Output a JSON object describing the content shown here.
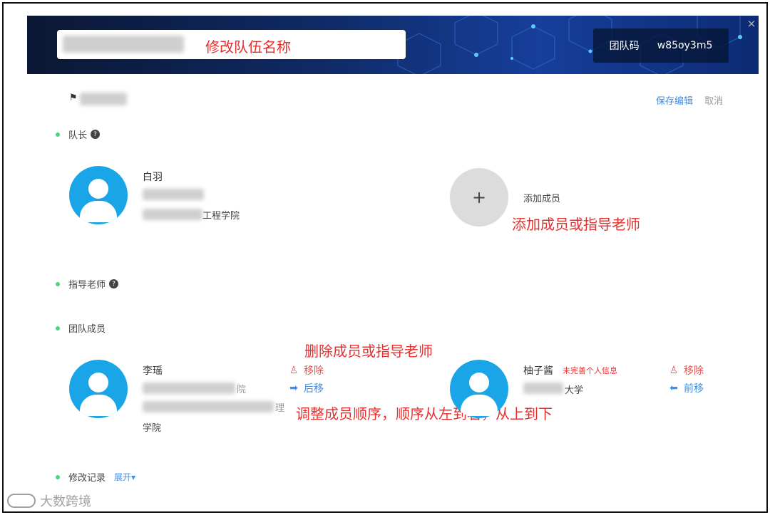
{
  "header": {
    "annotation_rename": "修改队伍名称",
    "team_code_label": "团队码",
    "team_code_value": "w85oy3m5",
    "close_icon": "×"
  },
  "top_actions": {
    "save_label": "保存编辑",
    "cancel_label": "取消"
  },
  "sections": {
    "captain_label": "队长",
    "advisor_label": "指导老师",
    "members_label": "团队成员",
    "history_label": "修改记录",
    "history_expand": "展开"
  },
  "captain": {
    "name": "白羽",
    "dept_suffix": "工程学院"
  },
  "add_member": {
    "label": "添加成员",
    "plus": "+",
    "annotation": "添加成员或指导老师"
  },
  "members": [
    {
      "name": "李瑶",
      "partial_text": "院",
      "partial_text2": "理",
      "dept_line": "学院",
      "remove_label": "移除",
      "move_label": "后移"
    },
    {
      "name": "柚子酱",
      "warning": "未完善个人信息",
      "school_suffix": "大学",
      "remove_label": "移除",
      "move_label": "前移"
    }
  ],
  "annotations": {
    "delete": "删除成员或指导老师",
    "order": "调整成员顺序，顺序从左到右，从上到下"
  },
  "watermark": "大数跨境",
  "colors": {
    "accent_blue": "#3d8ee8",
    "annotation_red": "#e53030",
    "avatar_blue": "#1aa5e8",
    "status_green": "#4cd67b"
  },
  "icons": [
    "flag-icon",
    "help-icon",
    "user-remove-icon",
    "arrow-right-icon",
    "arrow-left-icon",
    "plus-icon",
    "close-icon",
    "caret-down-icon"
  ]
}
